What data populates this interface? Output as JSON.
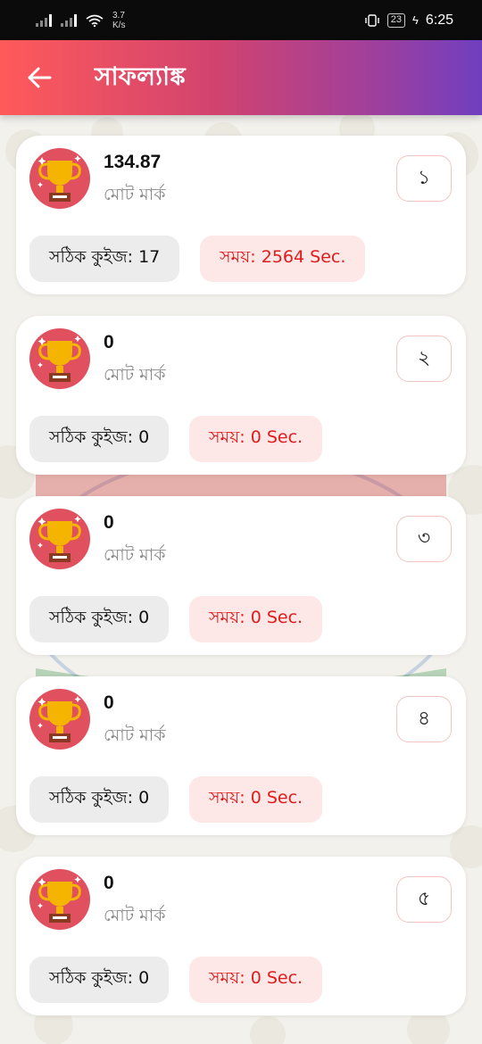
{
  "status_bar": {
    "speed_value": "3.7",
    "speed_unit": "K/s",
    "battery": "23",
    "time": "6:25"
  },
  "header": {
    "title": "সাফল্যাঙ্ক",
    "back_icon": "arrow-left-icon"
  },
  "results": [
    {
      "score": "134.87",
      "score_label": "মোট মার্ক",
      "rank": "১",
      "correct_label": "সঠিক কুইজ: 17",
      "time_label": "সময়: 2564 Sec."
    },
    {
      "score": "0",
      "score_label": "মোট মার্ক",
      "rank": "২",
      "correct_label": "সঠিক কুইজ: 0",
      "time_label": "সময়: 0 Sec."
    },
    {
      "score": "0",
      "score_label": "মোট মার্ক",
      "rank": "৩",
      "correct_label": "সঠিক কুইজ: 0",
      "time_label": "সময়: 0 Sec."
    },
    {
      "score": "0",
      "score_label": "মোট মার্ক",
      "rank": "৪",
      "correct_label": "সঠিক কুইজ: 0",
      "time_label": "সময়: 0 Sec."
    },
    {
      "score": "0",
      "score_label": "মোট মার্ক",
      "rank": "৫",
      "correct_label": "সঠিক কুইজ: 0",
      "time_label": "সময়: 0 Sec."
    }
  ],
  "colors": {
    "header_gradient_start": "#ff5a5a",
    "header_gradient_end": "#6f3fc0",
    "time_text": "#e01b1b",
    "time_bg": "#fde7e7",
    "trophy_circle": "#e0505f",
    "trophy_gold": "#f4b400"
  }
}
